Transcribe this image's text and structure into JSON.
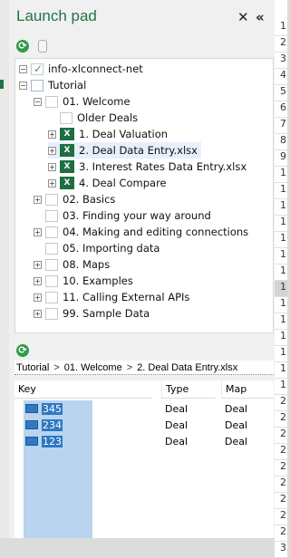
{
  "panel": {
    "title": "Launch pad",
    "close_label": "✕",
    "collapse_label": "«"
  },
  "tree": {
    "nodes": [
      {
        "label": "info-xlconnect-net"
      },
      {
        "label": "Tutorial"
      },
      {
        "label": "01. Welcome"
      },
      {
        "label": "Older Deals"
      },
      {
        "label": "1. Deal Valuation"
      },
      {
        "label": "2. Deal Data Entry.xlsx"
      },
      {
        "label": "3. Interest Rates Data Entry.xlsx"
      },
      {
        "label": "4. Deal Compare"
      },
      {
        "label": "02. Basics"
      },
      {
        "label": "03. Finding your way around"
      },
      {
        "label": "04. Making and editing connections"
      },
      {
        "label": "05. Importing data"
      },
      {
        "label": "08. Maps"
      },
      {
        "label": "10. Examples"
      },
      {
        "label": "11. Calling External APIs"
      },
      {
        "label": "99. Sample Data"
      }
    ]
  },
  "breadcrumb": [
    "Tutorial",
    "01. Welcome",
    "2. Deal Data Entry.xlsx"
  ],
  "grid": {
    "headers": {
      "key": "Key",
      "type": "Type",
      "map": "Map"
    },
    "rows": [
      {
        "key": "345",
        "type": "Deal",
        "map": "Deal"
      },
      {
        "key": "234",
        "type": "Deal",
        "map": "Deal"
      },
      {
        "key": "123",
        "type": "Deal",
        "map": "Deal"
      }
    ]
  },
  "row_numbers": [
    "1",
    "2",
    "3",
    "4",
    "5",
    "6",
    "7",
    "8",
    "9",
    "1",
    "1",
    "1",
    "1",
    "1",
    "1",
    "1",
    "1",
    "1",
    "1",
    "1",
    "1",
    "1",
    "1",
    "2",
    "2",
    "2",
    "2",
    "2",
    "2",
    "2",
    "2",
    "2",
    "3"
  ],
  "colors": {
    "accent": "#217346",
    "selection": "#b8d4ef",
    "key_badge": "#2f78c4"
  }
}
